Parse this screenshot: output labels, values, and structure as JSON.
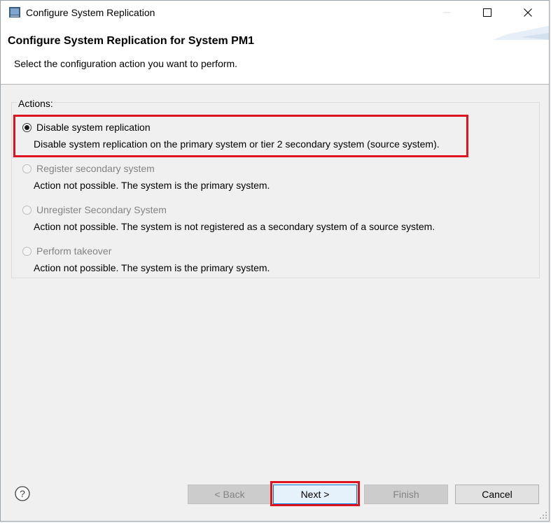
{
  "window": {
    "title": "Configure System Replication"
  },
  "header": {
    "title": "Configure System Replication for System PM1",
    "description": "Select the configuration action you want to perform."
  },
  "actions": {
    "group_label": "Actions:",
    "options": [
      {
        "label": "Disable system replication",
        "description": "Disable system replication on the primary system or tier 2 secondary system (source system).",
        "selected": true,
        "enabled": true
      },
      {
        "label": "Register secondary system",
        "description": "Action not possible. The system is the primary system.",
        "selected": false,
        "enabled": false
      },
      {
        "label": "Unregister Secondary System",
        "description": "Action not possible. The system is not registered as a secondary system of a source system.",
        "selected": false,
        "enabled": false
      },
      {
        "label": "Perform takeover",
        "description": "Action not possible. The system is the primary system.",
        "selected": false,
        "enabled": false
      }
    ]
  },
  "buttons": {
    "back": "< Back",
    "next": "Next >",
    "finish": "Finish",
    "cancel": "Cancel"
  },
  "icons": {
    "app": "app-icon",
    "minimize": "minimize-icon",
    "maximize": "maximize-icon",
    "close": "close-icon",
    "help": "help-icon"
  },
  "colors": {
    "highlight": "#e0141f",
    "focus": "#0078d7"
  }
}
